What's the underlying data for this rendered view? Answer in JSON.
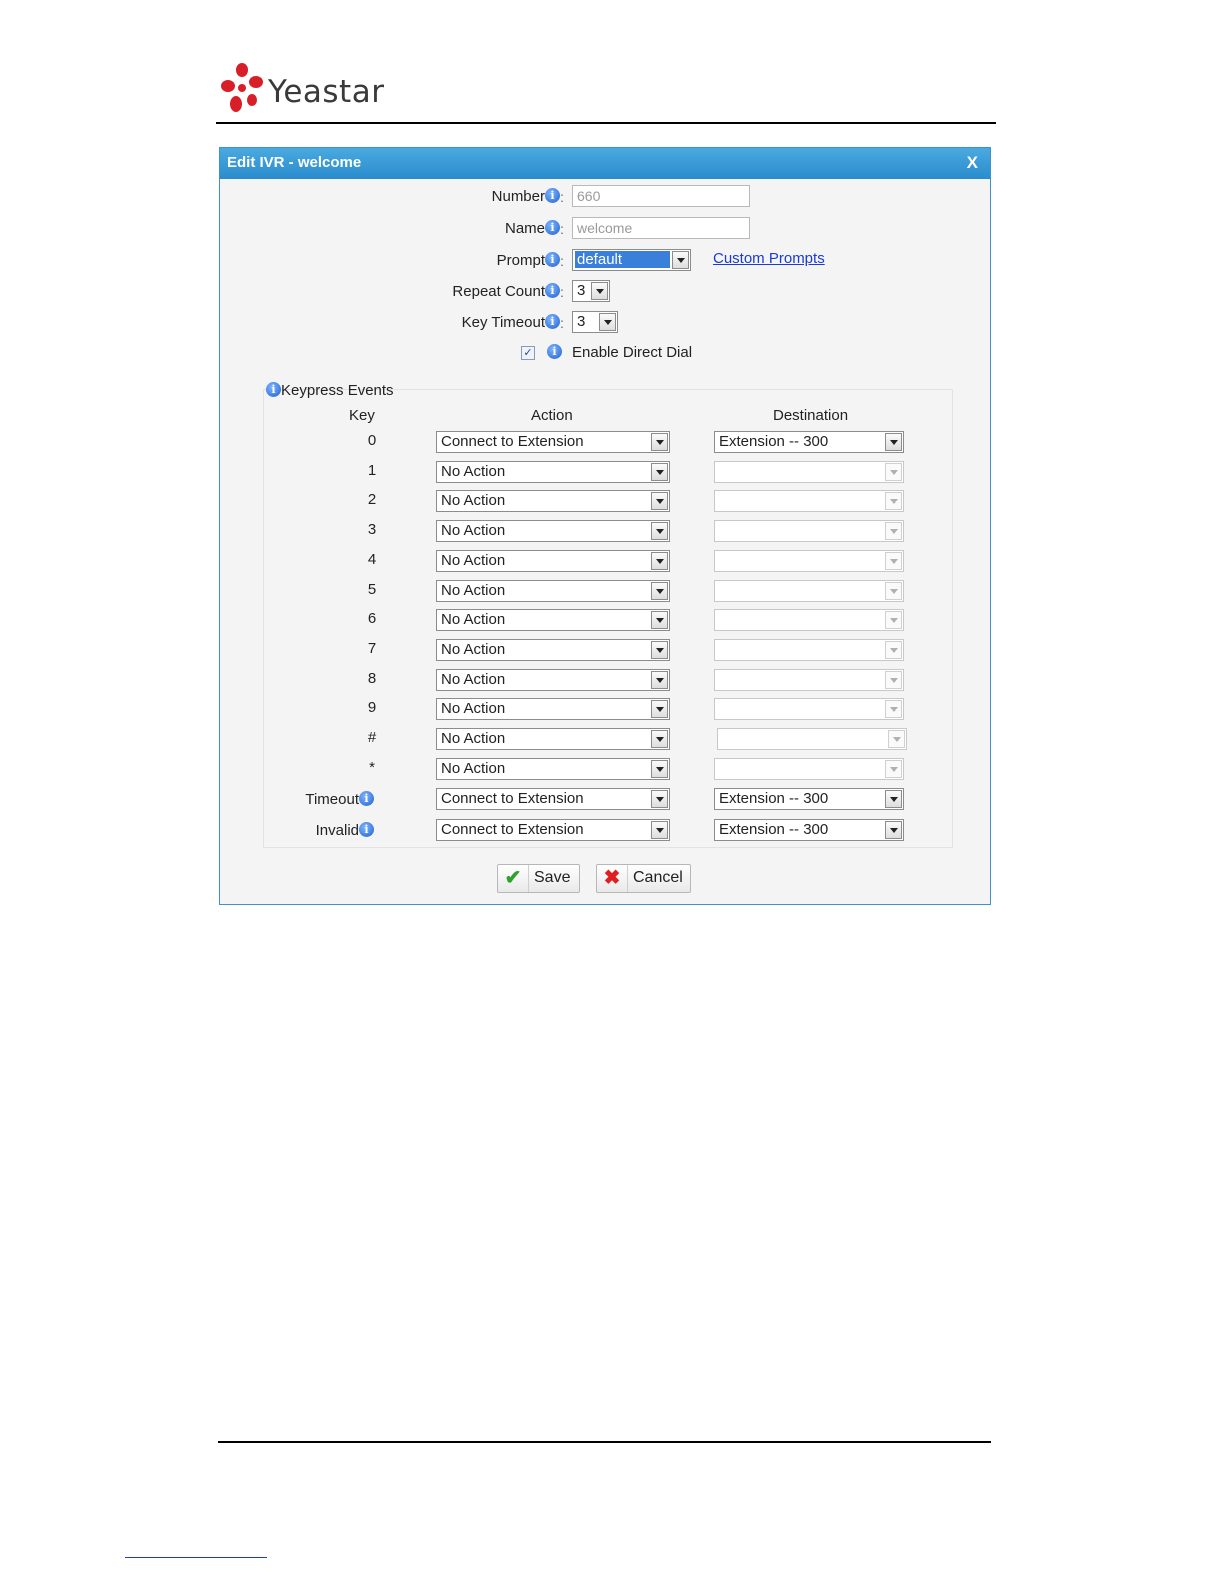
{
  "brand": {
    "name": "Yeastar"
  },
  "dialog": {
    "title": "Edit IVR - welcome",
    "close_label": "X"
  },
  "form": {
    "number": {
      "label": "Number",
      "value": "660"
    },
    "name": {
      "label": "Name",
      "value": "welcome"
    },
    "prompt": {
      "label": "Prompt",
      "value": "default",
      "link": "Custom Prompts"
    },
    "repeat_count": {
      "label": "Repeat Count",
      "value": "3"
    },
    "key_timeout": {
      "label": "Key Timeout",
      "value": "3"
    },
    "direct_dial": {
      "label": "Enable Direct Dial",
      "checked": true
    },
    "colon": ":"
  },
  "keypress": {
    "title": "Keypress Events",
    "headers": {
      "key": "Key",
      "action": "Action",
      "destination": "Destination"
    },
    "rows": [
      {
        "key": "0",
        "action": "Connect to Extension",
        "destination": "Extension -- 300"
      },
      {
        "key": "1",
        "action": "No Action",
        "destination": ""
      },
      {
        "key": "2",
        "action": "No Action",
        "destination": ""
      },
      {
        "key": "3",
        "action": "No Action",
        "destination": ""
      },
      {
        "key": "4",
        "action": "No Action",
        "destination": ""
      },
      {
        "key": "5",
        "action": "No Action",
        "destination": ""
      },
      {
        "key": "6",
        "action": "No Action",
        "destination": ""
      },
      {
        "key": "7",
        "action": "No Action",
        "destination": ""
      },
      {
        "key": "8",
        "action": "No Action",
        "destination": ""
      },
      {
        "key": "9",
        "action": "No Action",
        "destination": ""
      },
      {
        "key": "#",
        "action": "No Action",
        "destination": ""
      },
      {
        "key": "*",
        "action": "No Action",
        "destination": ""
      }
    ],
    "timeout": {
      "label": "Timeout",
      "action": "Connect to Extension",
      "destination": "Extension -- 300"
    },
    "invalid": {
      "label": "Invalid",
      "action": "Connect to Extension",
      "destination": "Extension -- 300"
    }
  },
  "buttons": {
    "save": "Save",
    "cancel": "Cancel"
  },
  "icons": {
    "info": "i",
    "check": "✔",
    "cancel": "✖",
    "checkbox": "✓"
  },
  "colors": {
    "title_bar": "#2a8ccd",
    "link": "#1b3bd6",
    "save_icon": "#2fa12f",
    "cancel_icon": "#e02020"
  }
}
